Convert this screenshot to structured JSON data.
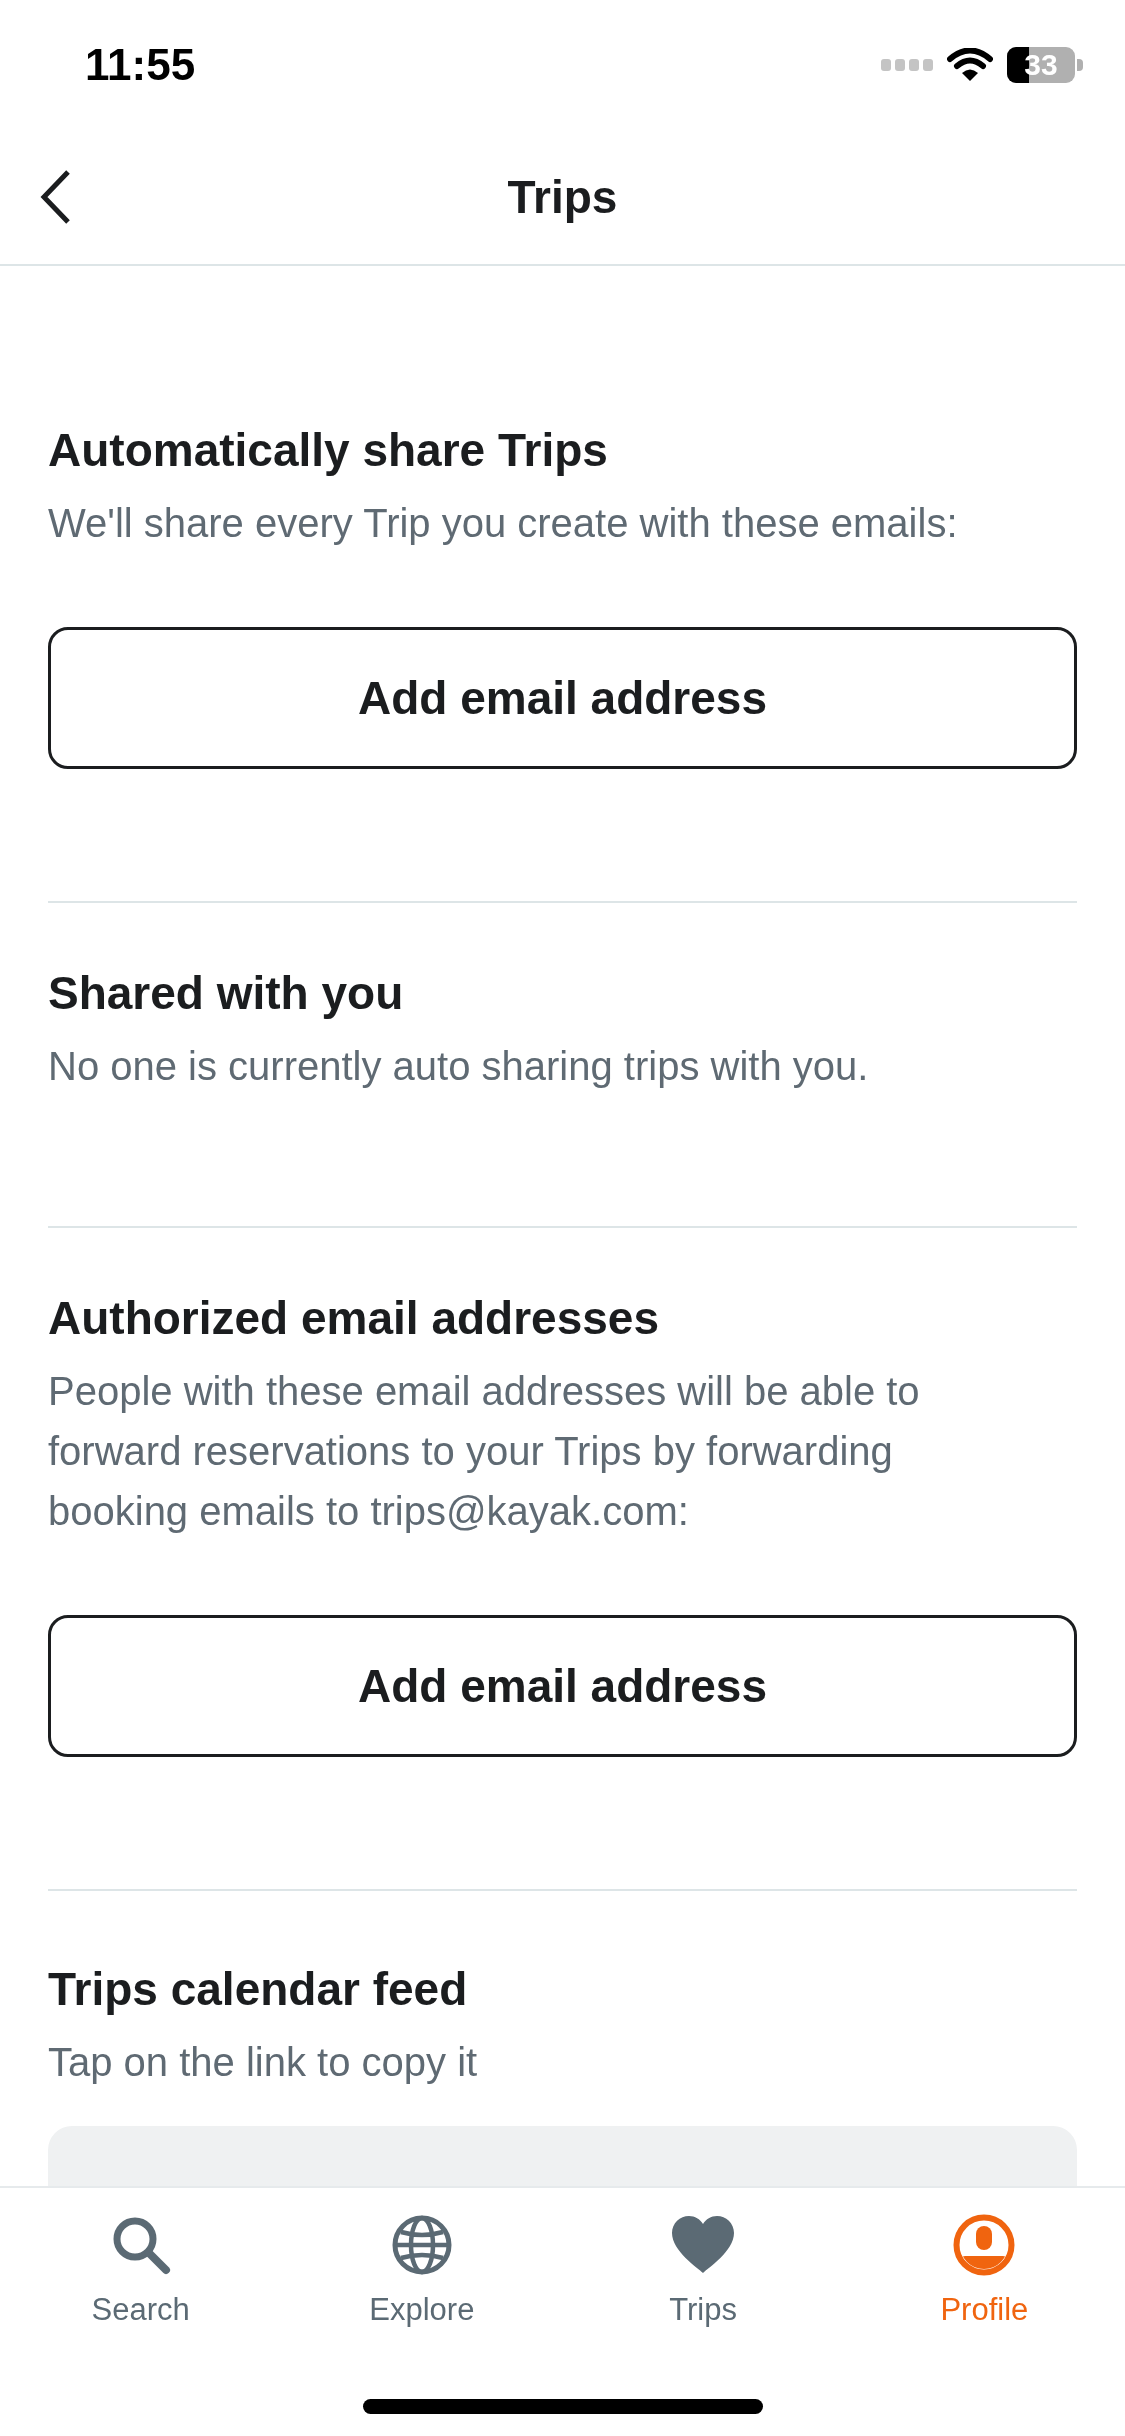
{
  "status_bar": {
    "time": "11:55",
    "battery": "33"
  },
  "header": {
    "title": "Trips"
  },
  "sections": [
    {
      "kind": "button",
      "heading": "Automatically share Trips",
      "description": "We'll share every Trip you create with these emails:",
      "button": "Add email address"
    },
    {
      "kind": "text",
      "heading": "Shared with you",
      "description": "No one is currently auto sharing trips with you."
    },
    {
      "kind": "button",
      "heading": "Authorized email addresses",
      "description": "People with these email addresses will be able to forward reservations to your Trips by forwarding booking emails to trips@kayak.com:",
      "button": "Add email address"
    },
    {
      "kind": "link",
      "heading": "Trips calendar feed",
      "description": "Tap on the link to copy it"
    }
  ],
  "tab_bar": [
    {
      "label": "Search",
      "selected": false
    },
    {
      "label": "Explore",
      "selected": false
    },
    {
      "label": "Trips",
      "selected": false
    },
    {
      "label": "Profile",
      "selected": true
    }
  ]
}
